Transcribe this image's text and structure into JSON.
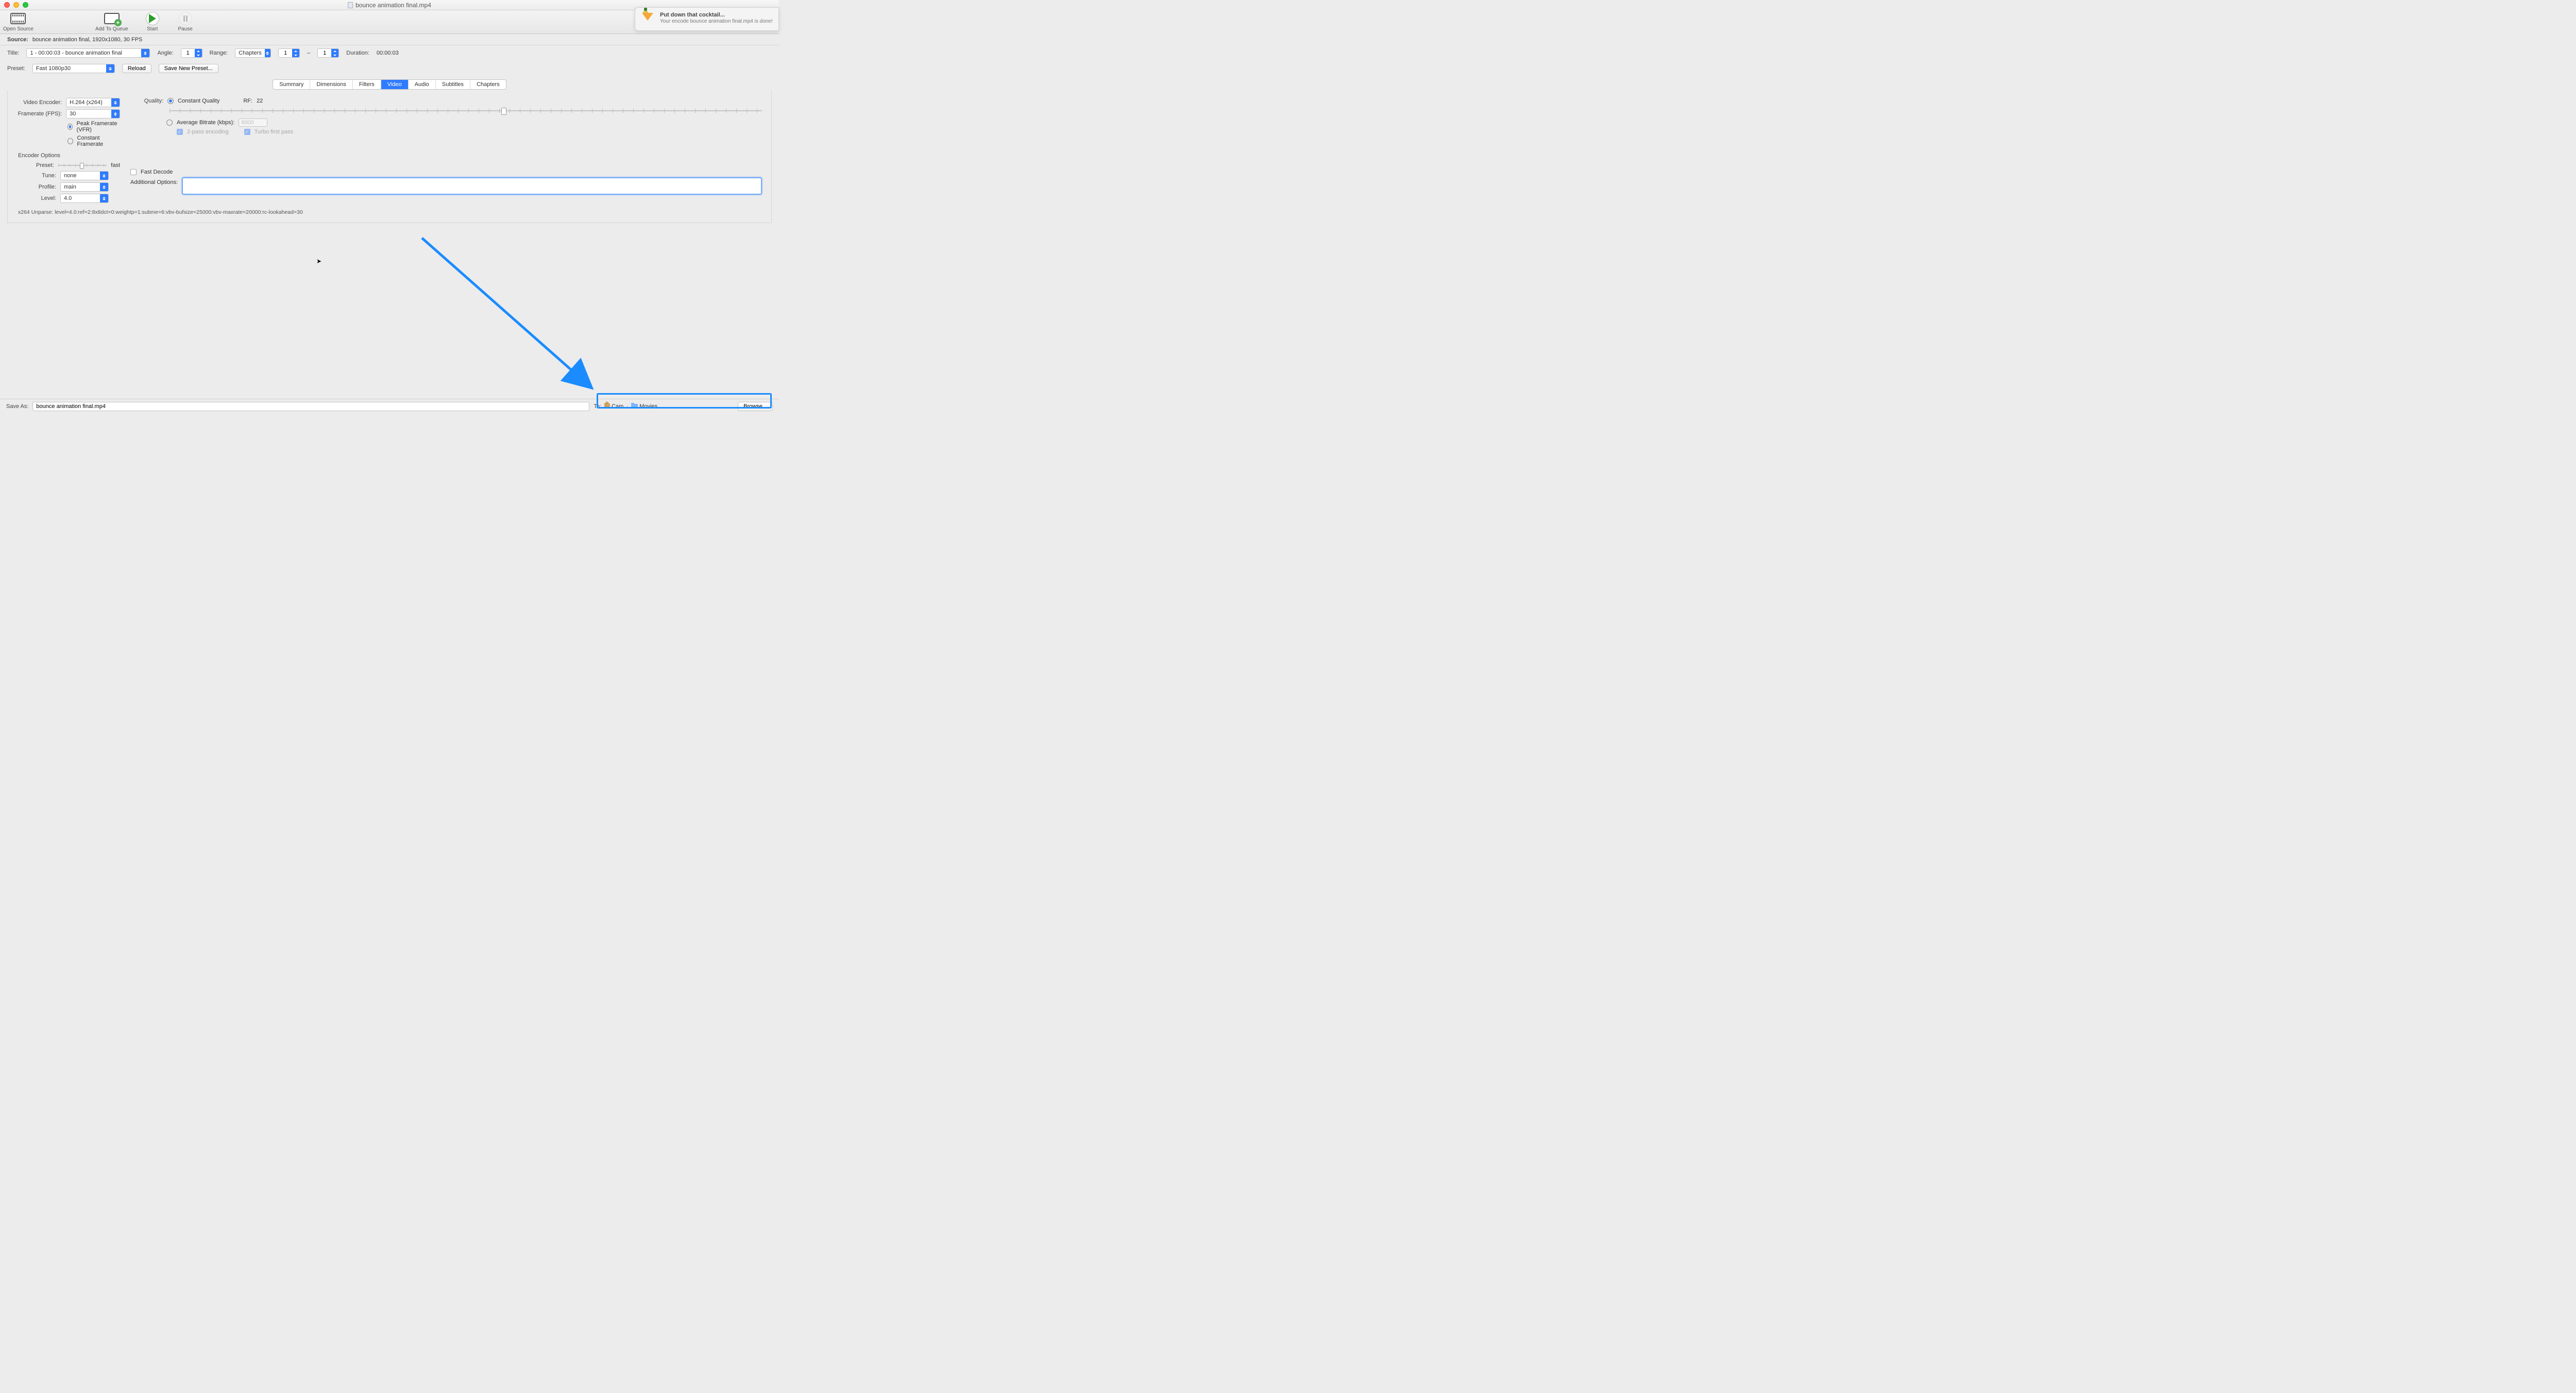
{
  "window": {
    "title": "bounce animation final.mp4"
  },
  "toolbar": {
    "open_source": "Open Source",
    "add_to_queue": "Add To Queue",
    "start": "Start",
    "pause": "Pause"
  },
  "source": {
    "label": "Source:",
    "value": "bounce animation final, 1920x1080, 30 FPS"
  },
  "title_row": {
    "label": "Title:",
    "value": "1 - 00:00:03 - bounce animation final",
    "angle_label": "Angle:",
    "angle": "1",
    "range_label": "Range:",
    "range_mode": "Chapters",
    "range_from": "1",
    "range_to": "1",
    "duration_label": "Duration:",
    "duration": "00:00:03"
  },
  "preset_row": {
    "label": "Preset:",
    "value": "Fast 1080p30",
    "reload": "Reload",
    "save_new": "Save New Preset..."
  },
  "tabs": [
    "Summary",
    "Dimensions",
    "Filters",
    "Video",
    "Audio",
    "Subtitles",
    "Chapters"
  ],
  "active_tab": "Video",
  "video": {
    "encoder_label": "Video Encoder:",
    "encoder": "H.264 (x264)",
    "fps_label": "Framerate (FPS):",
    "fps": "30",
    "peak": "Peak Framerate (VFR)",
    "constant_fr": "Constant Framerate",
    "quality_label": "Quality:",
    "cq_label": "Constant Quality",
    "rf_label": "RF:",
    "rf_value": "22",
    "abr_label": "Average Bitrate (kbps):",
    "abr_value": "6000",
    "twopass": "2-pass encoding",
    "turbo": "Turbo first pass"
  },
  "encoder_opts": {
    "section": "Encoder Options",
    "preset_label": "Preset:",
    "preset_speed": "fast",
    "tune_label": "Tune:",
    "tune": "none",
    "fast_decode": "Fast Decode",
    "profile_label": "Profile:",
    "profile": "main",
    "level_label": "Level:",
    "level": "4.0",
    "additional_label": "Additional Options:",
    "additional": ""
  },
  "unparse": "x264 Unparse: level=4.0:ref=2:8x8dct=0:weightp=1:subme=6:vbv-bufsize=25000:vbv-maxrate=20000:rc-lookahead=30",
  "bottom": {
    "saveas_label": "Save As:",
    "saveas_value": "bounce animation final.mp4",
    "to_label": "To:",
    "crumb1": "Cam",
    "crumb2": "Movies",
    "browse": "Browse..."
  },
  "notification": {
    "title": "Put down that cocktail...",
    "body": "Your encode bounce animation final.mp4 is done!"
  }
}
